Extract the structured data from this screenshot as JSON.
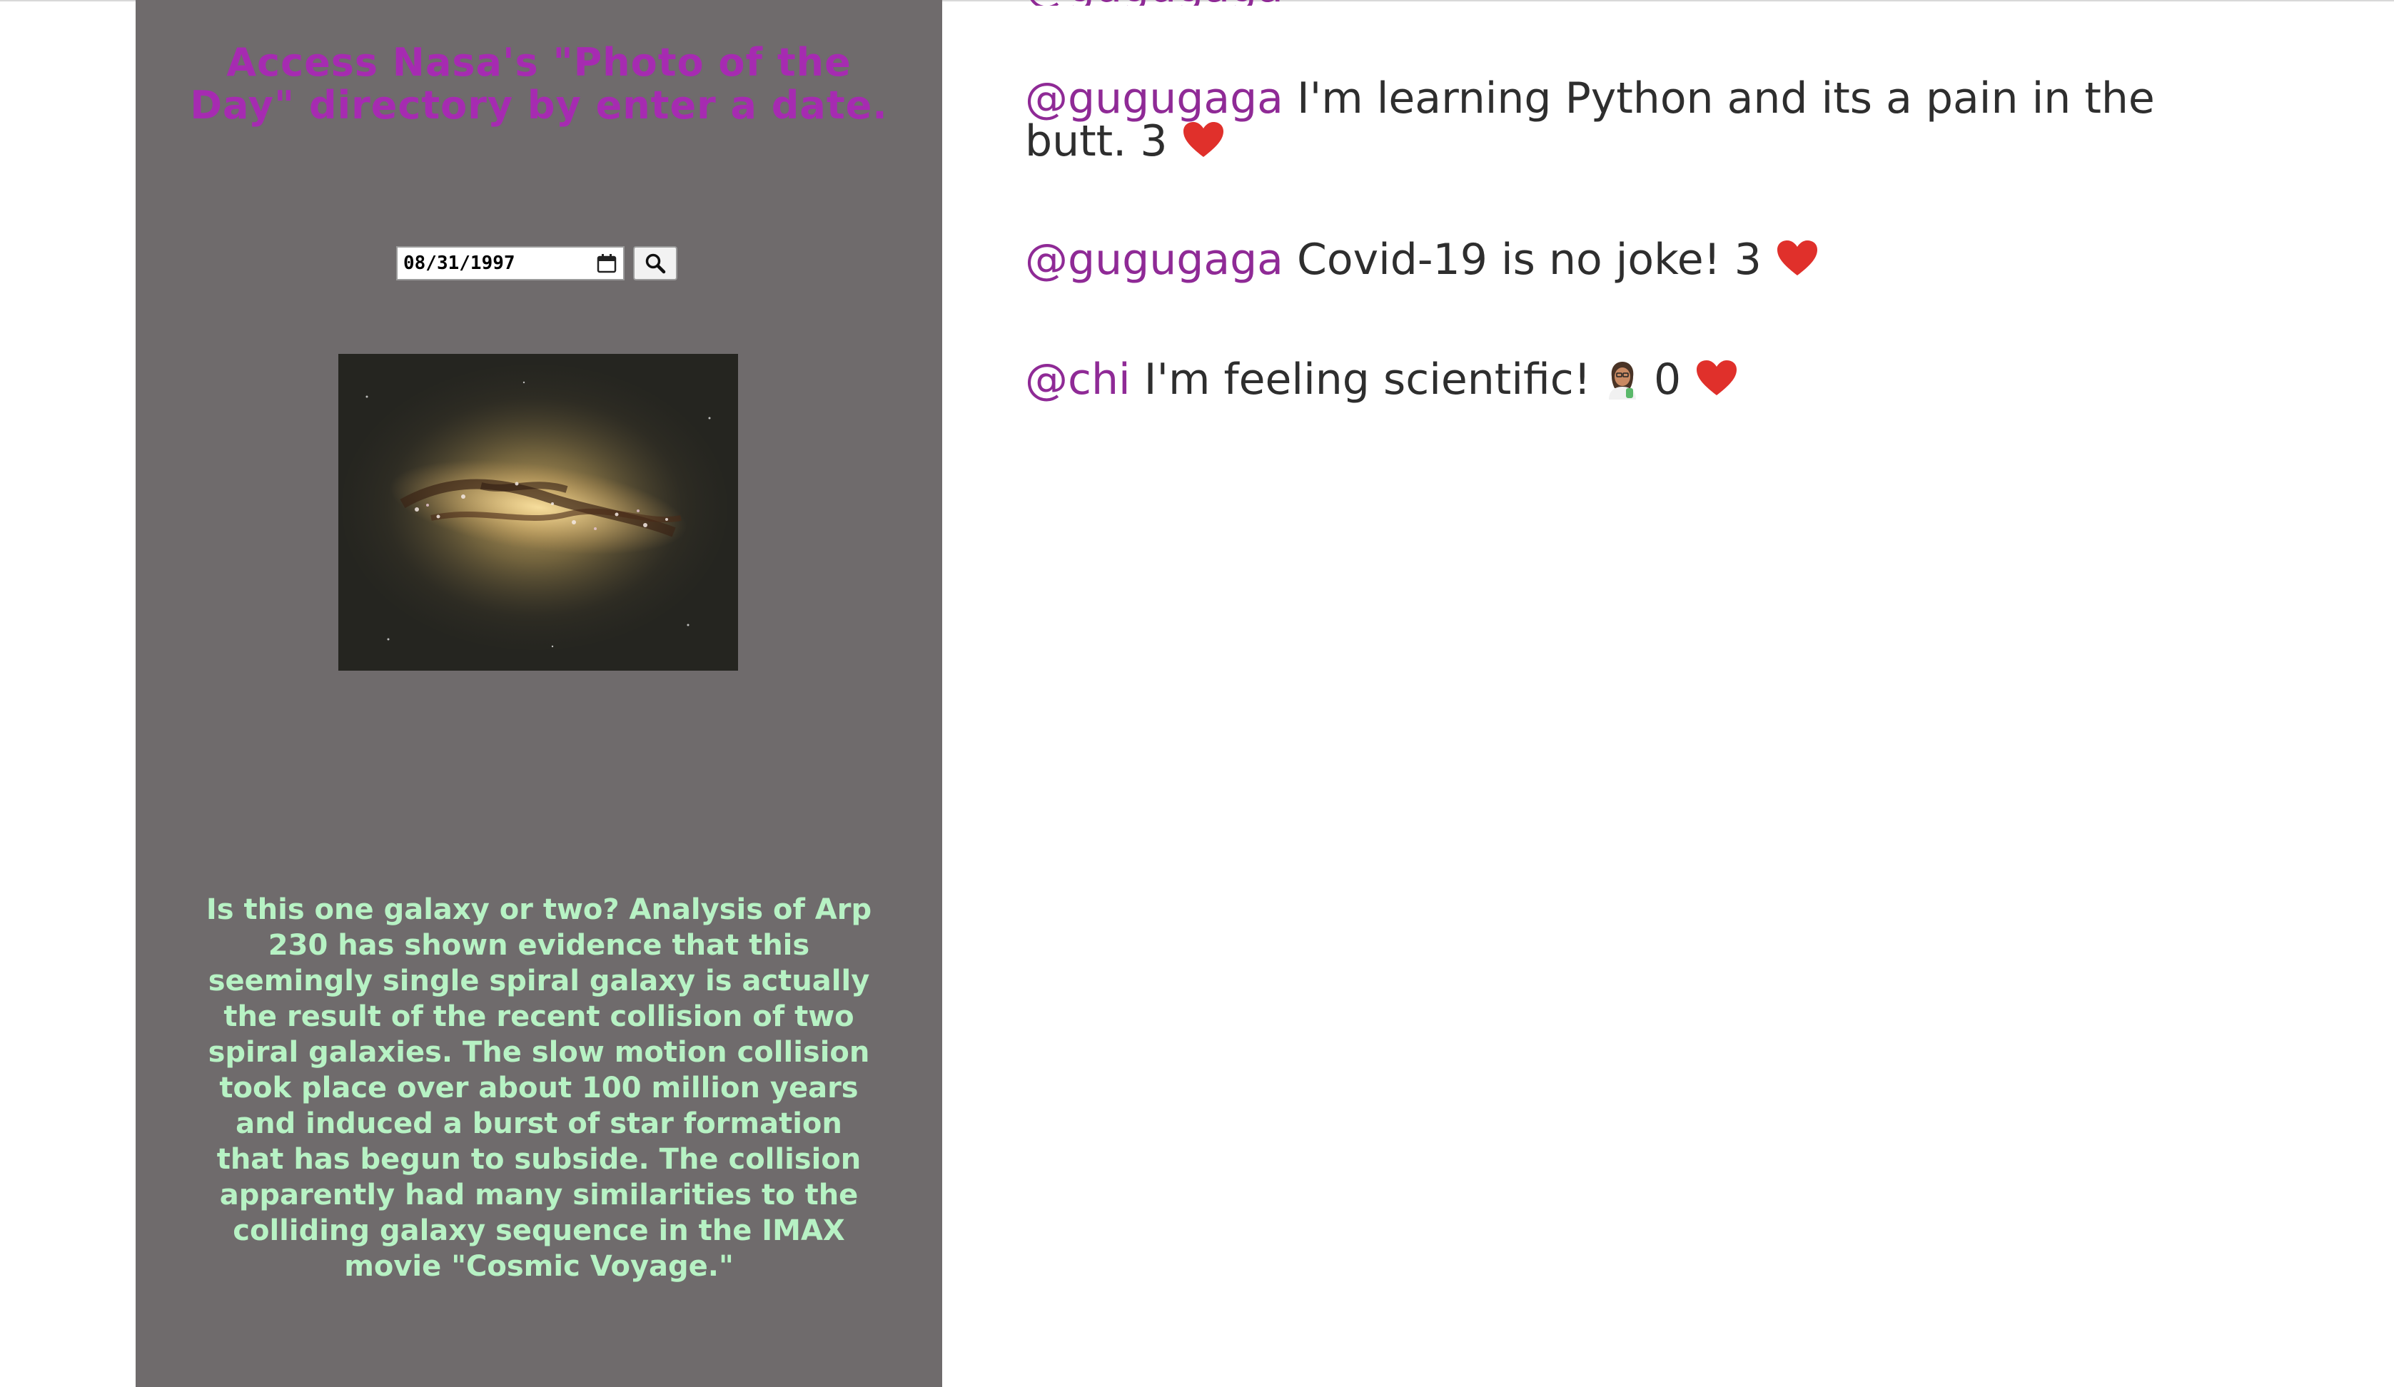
{
  "nasa": {
    "title": "Access Nasa's \"Photo of the Day\" directory by enter a date.",
    "date_value": "08/31/1997",
    "image_alt": "Arp 230 galaxy",
    "description": "Is this one galaxy or two? Analysis of Arp 230 has shown evidence that this seemingly single spiral galaxy is actually the result of the recent collision of two spiral galaxies. The slow motion collision took place over about 100 million years and induced a burst of star formation that has begun to subside. The collision apparently had many similarities to the colliding galaxy sequence in the IMAX movie \"Cosmic Voyage.\"",
    "colors": {
      "panel_bg": "#6f6b6c",
      "title": "#a62bb1",
      "description": "#b7f2c4"
    }
  },
  "feed": {
    "posts": [
      {
        "handle": "@gugugaga",
        "text": "I'm learning Python and its a pain in the butt.",
        "likes": "3",
        "icon": "heart-icon"
      },
      {
        "handle": "@gugugaga",
        "text": "Covid-19 is no joke!",
        "likes": "3",
        "icon": "heart-icon"
      },
      {
        "handle": "@chi",
        "text": "I'm feeling scientific!",
        "emoji": "scientist-icon",
        "likes": "0",
        "icon": "heart-icon"
      }
    ],
    "colors": {
      "handle": "#8f2a96",
      "text": "#2e2e2e",
      "heart": "#e0302b"
    }
  }
}
